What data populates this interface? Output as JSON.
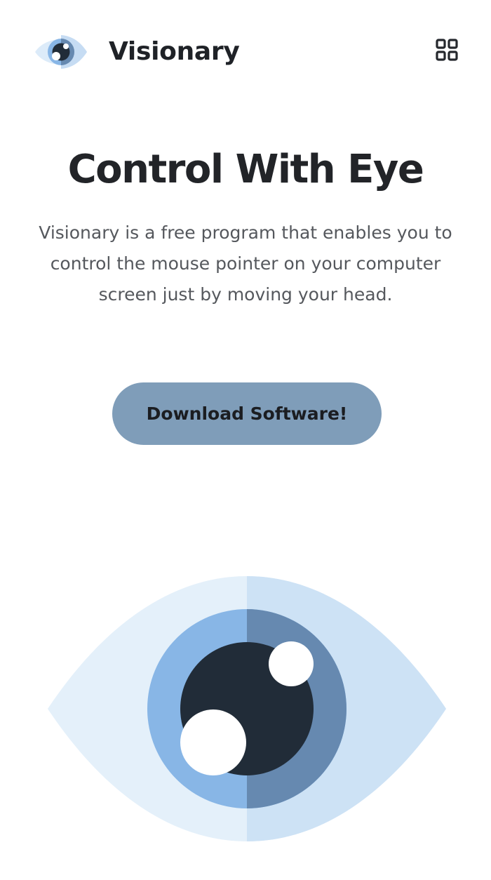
{
  "header": {
    "brand": "Visionary",
    "logo_icon": "eye-icon",
    "menu_icon": "grid-menu-icon"
  },
  "hero": {
    "title": "Control With Eye",
    "description": "Visionary is a free program that enables you to control the mouse pointer on your computer screen just by moving your head.",
    "cta_label": "Download Software!",
    "illustration_icon": "eye-illustration"
  },
  "colors": {
    "accent": "#7f9db9",
    "eye_light": "#e4f0fa",
    "eye_light_shade": "#cde2f5",
    "iris": "#88b6e6",
    "iris_shade": "#6689b0",
    "pupil": "#212c38",
    "text_dark": "#222428",
    "text_muted": "#55585d"
  }
}
